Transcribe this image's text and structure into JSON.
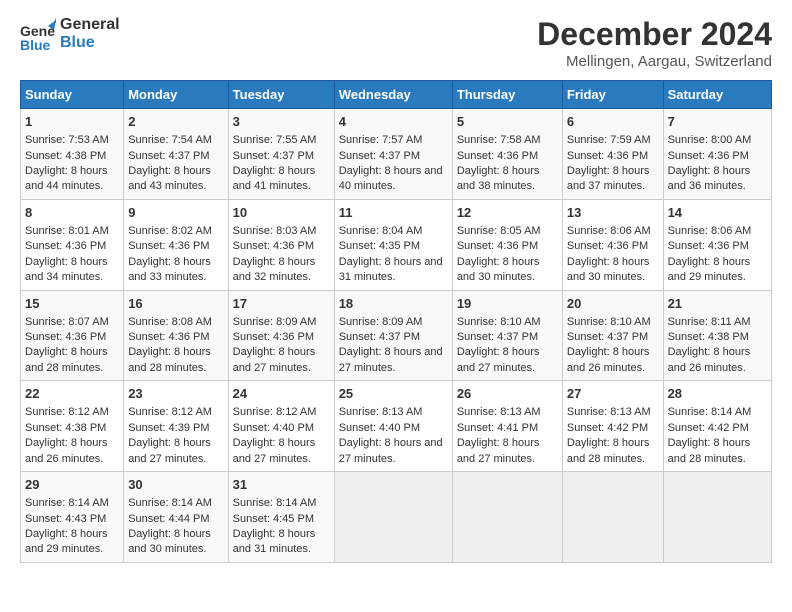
{
  "logo": {
    "general": "General",
    "blue": "Blue"
  },
  "title": "December 2024",
  "subtitle": "Mellingen, Aargau, Switzerland",
  "columns": [
    "Sunday",
    "Monday",
    "Tuesday",
    "Wednesday",
    "Thursday",
    "Friday",
    "Saturday"
  ],
  "weeks": [
    [
      {
        "day": "1",
        "sunrise": "Sunrise: 7:53 AM",
        "sunset": "Sunset: 4:38 PM",
        "daylight": "Daylight: 8 hours and 44 minutes."
      },
      {
        "day": "2",
        "sunrise": "Sunrise: 7:54 AM",
        "sunset": "Sunset: 4:37 PM",
        "daylight": "Daylight: 8 hours and 43 minutes."
      },
      {
        "day": "3",
        "sunrise": "Sunrise: 7:55 AM",
        "sunset": "Sunset: 4:37 PM",
        "daylight": "Daylight: 8 hours and 41 minutes."
      },
      {
        "day": "4",
        "sunrise": "Sunrise: 7:57 AM",
        "sunset": "Sunset: 4:37 PM",
        "daylight": "Daylight: 8 hours and 40 minutes."
      },
      {
        "day": "5",
        "sunrise": "Sunrise: 7:58 AM",
        "sunset": "Sunset: 4:36 PM",
        "daylight": "Daylight: 8 hours and 38 minutes."
      },
      {
        "day": "6",
        "sunrise": "Sunrise: 7:59 AM",
        "sunset": "Sunset: 4:36 PM",
        "daylight": "Daylight: 8 hours and 37 minutes."
      },
      {
        "day": "7",
        "sunrise": "Sunrise: 8:00 AM",
        "sunset": "Sunset: 4:36 PM",
        "daylight": "Daylight: 8 hours and 36 minutes."
      }
    ],
    [
      {
        "day": "8",
        "sunrise": "Sunrise: 8:01 AM",
        "sunset": "Sunset: 4:36 PM",
        "daylight": "Daylight: 8 hours and 34 minutes."
      },
      {
        "day": "9",
        "sunrise": "Sunrise: 8:02 AM",
        "sunset": "Sunset: 4:36 PM",
        "daylight": "Daylight: 8 hours and 33 minutes."
      },
      {
        "day": "10",
        "sunrise": "Sunrise: 8:03 AM",
        "sunset": "Sunset: 4:36 PM",
        "daylight": "Daylight: 8 hours and 32 minutes."
      },
      {
        "day": "11",
        "sunrise": "Sunrise: 8:04 AM",
        "sunset": "Sunset: 4:35 PM",
        "daylight": "Daylight: 8 hours and 31 minutes."
      },
      {
        "day": "12",
        "sunrise": "Sunrise: 8:05 AM",
        "sunset": "Sunset: 4:36 PM",
        "daylight": "Daylight: 8 hours and 30 minutes."
      },
      {
        "day": "13",
        "sunrise": "Sunrise: 8:06 AM",
        "sunset": "Sunset: 4:36 PM",
        "daylight": "Daylight: 8 hours and 30 minutes."
      },
      {
        "day": "14",
        "sunrise": "Sunrise: 8:06 AM",
        "sunset": "Sunset: 4:36 PM",
        "daylight": "Daylight: 8 hours and 29 minutes."
      }
    ],
    [
      {
        "day": "15",
        "sunrise": "Sunrise: 8:07 AM",
        "sunset": "Sunset: 4:36 PM",
        "daylight": "Daylight: 8 hours and 28 minutes."
      },
      {
        "day": "16",
        "sunrise": "Sunrise: 8:08 AM",
        "sunset": "Sunset: 4:36 PM",
        "daylight": "Daylight: 8 hours and 28 minutes."
      },
      {
        "day": "17",
        "sunrise": "Sunrise: 8:09 AM",
        "sunset": "Sunset: 4:36 PM",
        "daylight": "Daylight: 8 hours and 27 minutes."
      },
      {
        "day": "18",
        "sunrise": "Sunrise: 8:09 AM",
        "sunset": "Sunset: 4:37 PM",
        "daylight": "Daylight: 8 hours and 27 minutes."
      },
      {
        "day": "19",
        "sunrise": "Sunrise: 8:10 AM",
        "sunset": "Sunset: 4:37 PM",
        "daylight": "Daylight: 8 hours and 27 minutes."
      },
      {
        "day": "20",
        "sunrise": "Sunrise: 8:10 AM",
        "sunset": "Sunset: 4:37 PM",
        "daylight": "Daylight: 8 hours and 26 minutes."
      },
      {
        "day": "21",
        "sunrise": "Sunrise: 8:11 AM",
        "sunset": "Sunset: 4:38 PM",
        "daylight": "Daylight: 8 hours and 26 minutes."
      }
    ],
    [
      {
        "day": "22",
        "sunrise": "Sunrise: 8:12 AM",
        "sunset": "Sunset: 4:38 PM",
        "daylight": "Daylight: 8 hours and 26 minutes."
      },
      {
        "day": "23",
        "sunrise": "Sunrise: 8:12 AM",
        "sunset": "Sunset: 4:39 PM",
        "daylight": "Daylight: 8 hours and 27 minutes."
      },
      {
        "day": "24",
        "sunrise": "Sunrise: 8:12 AM",
        "sunset": "Sunset: 4:40 PM",
        "daylight": "Daylight: 8 hours and 27 minutes."
      },
      {
        "day": "25",
        "sunrise": "Sunrise: 8:13 AM",
        "sunset": "Sunset: 4:40 PM",
        "daylight": "Daylight: 8 hours and 27 minutes."
      },
      {
        "day": "26",
        "sunrise": "Sunrise: 8:13 AM",
        "sunset": "Sunset: 4:41 PM",
        "daylight": "Daylight: 8 hours and 27 minutes."
      },
      {
        "day": "27",
        "sunrise": "Sunrise: 8:13 AM",
        "sunset": "Sunset: 4:42 PM",
        "daylight": "Daylight: 8 hours and 28 minutes."
      },
      {
        "day": "28",
        "sunrise": "Sunrise: 8:14 AM",
        "sunset": "Sunset: 4:42 PM",
        "daylight": "Daylight: 8 hours and 28 minutes."
      }
    ],
    [
      {
        "day": "29",
        "sunrise": "Sunrise: 8:14 AM",
        "sunset": "Sunset: 4:43 PM",
        "daylight": "Daylight: 8 hours and 29 minutes."
      },
      {
        "day": "30",
        "sunrise": "Sunrise: 8:14 AM",
        "sunset": "Sunset: 4:44 PM",
        "daylight": "Daylight: 8 hours and 30 minutes."
      },
      {
        "day": "31",
        "sunrise": "Sunrise: 8:14 AM",
        "sunset": "Sunset: 4:45 PM",
        "daylight": "Daylight: 8 hours and 31 minutes."
      },
      null,
      null,
      null,
      null
    ]
  ]
}
